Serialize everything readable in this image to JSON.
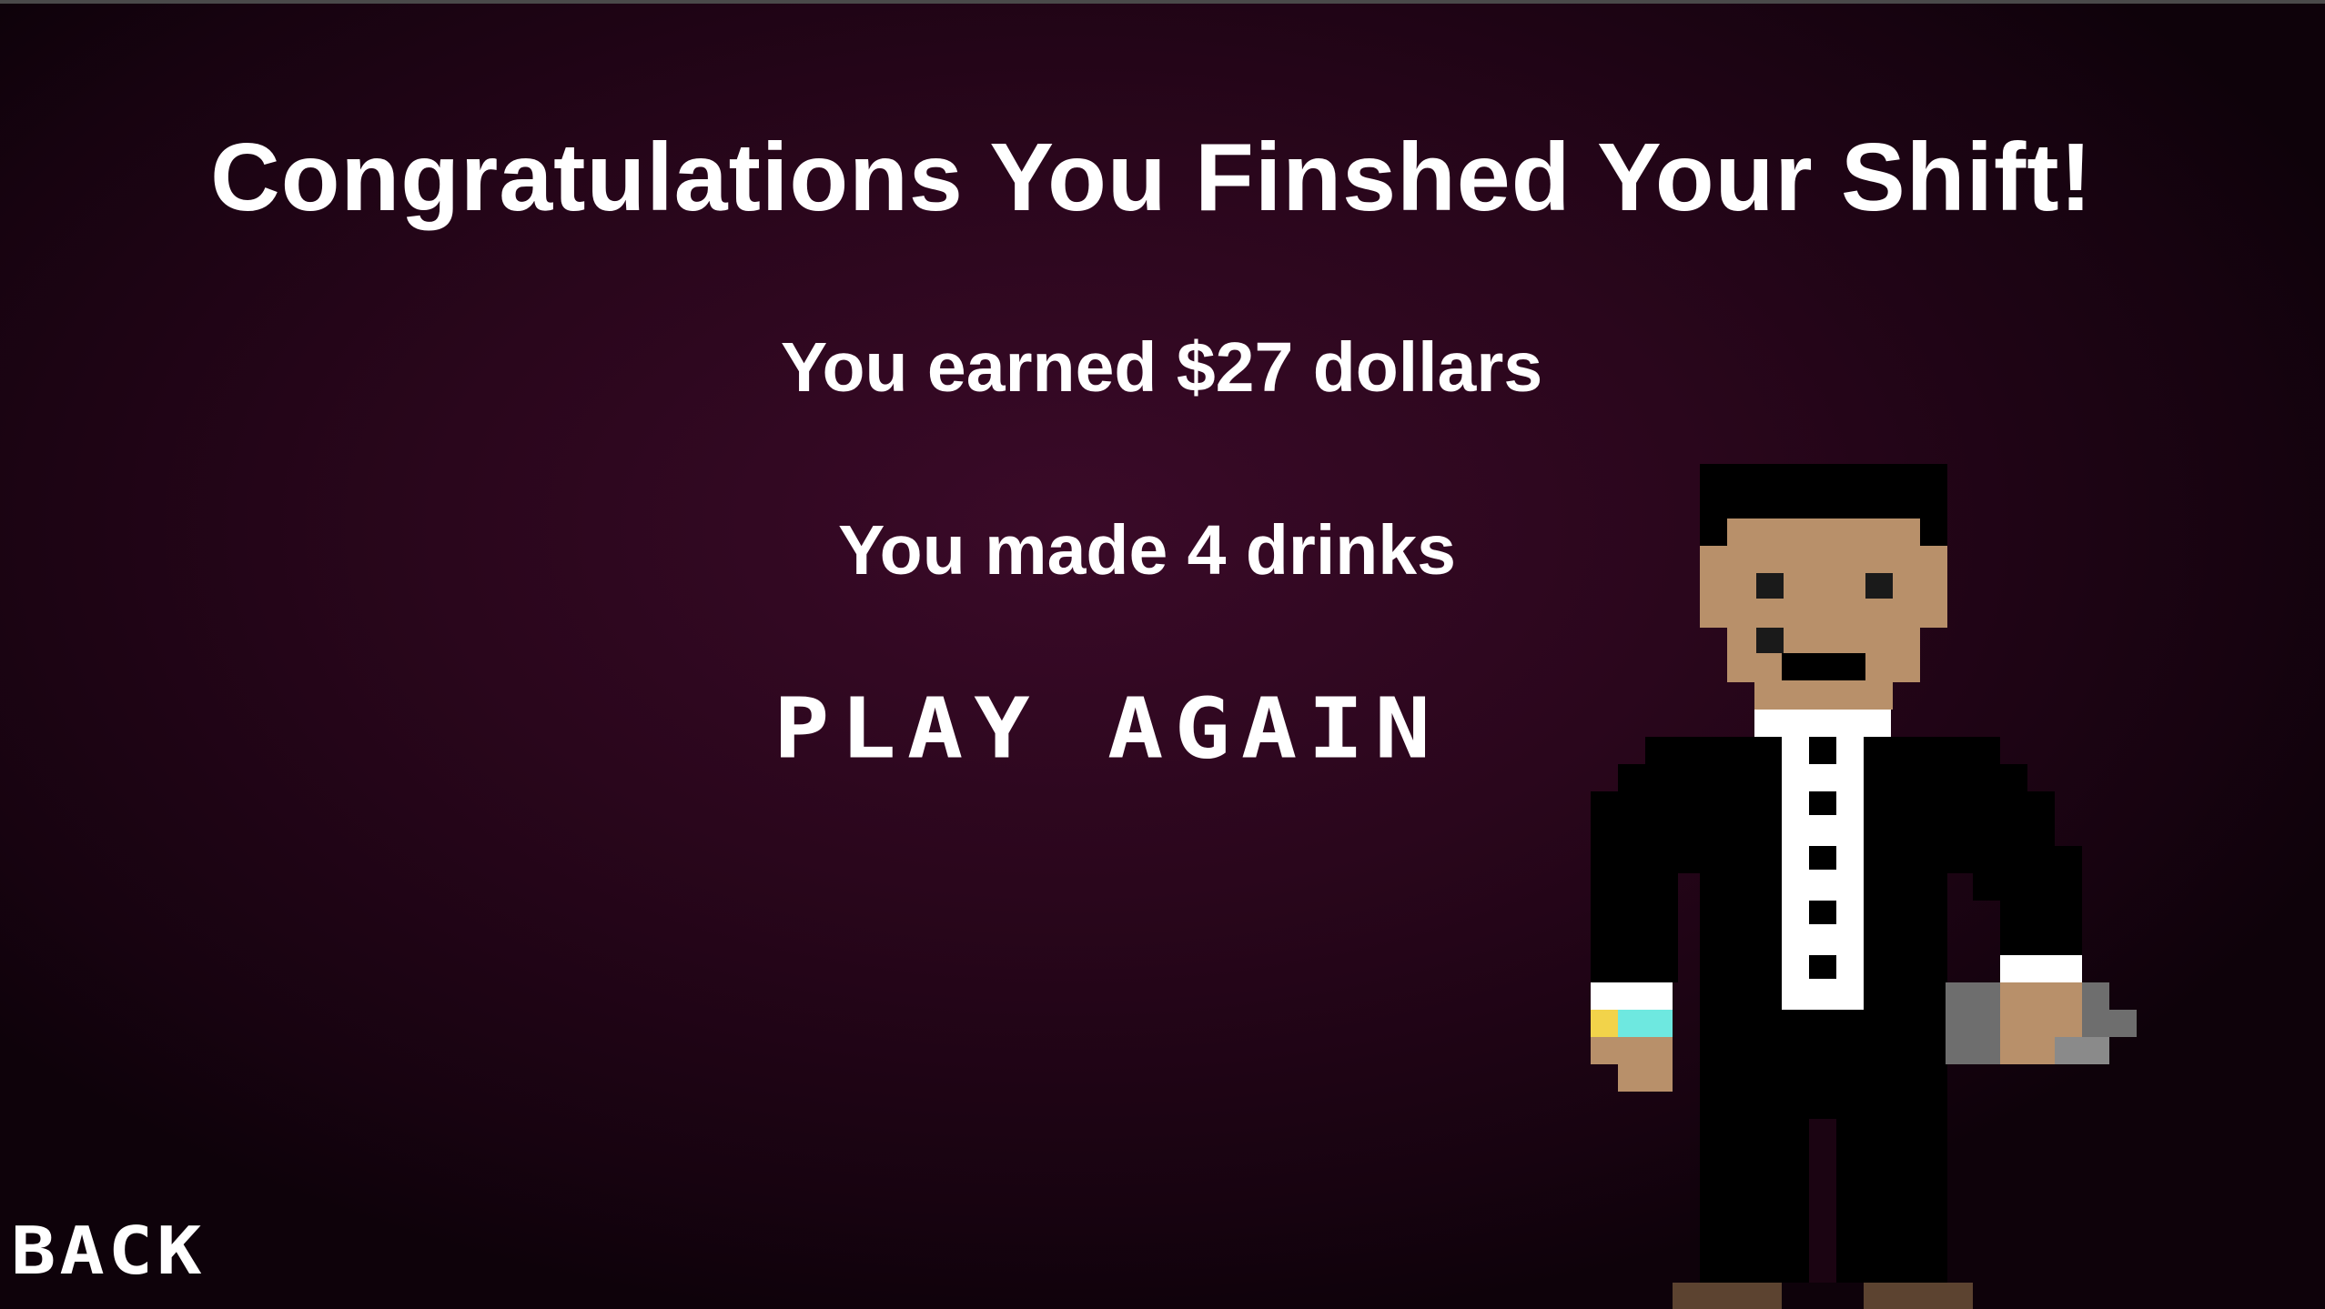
{
  "screen": {
    "headline": "Congratulations You Finshed Your Shift!",
    "earned_text": "You earned $27 dollars",
    "drinks_text": "You made 4 drinks"
  },
  "buttons": {
    "play_again_label": "PLAY AGAIN",
    "back_label": "BACK"
  },
  "character": {
    "icon": "bartender-sprite",
    "colors": {
      "skin": "#b8906a",
      "hair": "#000000",
      "suit": "#000000",
      "shirt": "#ffffff",
      "shoes": "#5c4330",
      "bottle": "#6e6e6e",
      "bracelet_yellow": "#f2d34a",
      "bracelet_cyan": "#6ee8e0"
    }
  },
  "theme": {
    "background": "#2a061c",
    "text": "#ffffff"
  }
}
